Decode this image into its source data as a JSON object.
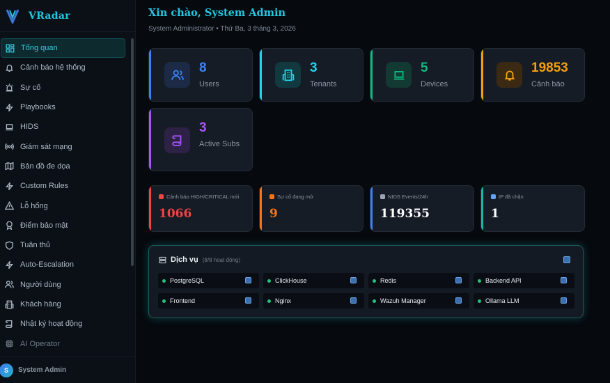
{
  "brand": {
    "name": "VRadar"
  },
  "sidebar": {
    "items": [
      {
        "label": "Tổng quan",
        "icon": "dashboard-icon",
        "active": true
      },
      {
        "label": "Cảnh báo hệ thống",
        "icon": "bell-icon"
      },
      {
        "label": "Sự cố",
        "icon": "incident-icon"
      },
      {
        "label": "Playbooks",
        "icon": "bolt-icon"
      },
      {
        "label": "HIDS",
        "icon": "laptop-icon"
      },
      {
        "label": "Giám sát mạng",
        "icon": "radio-icon"
      },
      {
        "label": "Bản đồ đe dọa",
        "icon": "map-icon"
      },
      {
        "label": "Custom Rules",
        "icon": "bolt-icon"
      },
      {
        "label": "Lỗ hổng",
        "icon": "warning-icon"
      },
      {
        "label": "Điểm bảo mật",
        "icon": "award-icon"
      },
      {
        "label": "Tuân thủ",
        "icon": "shield-icon"
      },
      {
        "label": "Auto-Escalation",
        "icon": "bolt-icon"
      },
      {
        "label": "Người dùng",
        "icon": "users-icon"
      },
      {
        "label": "Khách hàng",
        "icon": "building-icon"
      },
      {
        "label": "Nhật ký hoạt động",
        "icon": "scroll-icon"
      },
      {
        "label": "AI Operator",
        "icon": "cpu-icon"
      }
    ]
  },
  "user": {
    "initial": "S",
    "name": "System Admin"
  },
  "header": {
    "greeting": "Xin chào, System Admin",
    "subtitle": "System Administrator • Thứ Ba, 3 tháng 3, 2026"
  },
  "stats": [
    {
      "value": "8",
      "label": "Users",
      "icon": "users-icon",
      "color": "#3b82f6"
    },
    {
      "value": "3",
      "label": "Tenants",
      "icon": "building-icon",
      "color": "#22d3ee"
    },
    {
      "value": "5",
      "label": "Devices",
      "icon": "laptop-icon",
      "color": "#10b981"
    },
    {
      "value": "19853",
      "label": "Cảnh báo",
      "icon": "bell-icon",
      "color": "#f59e0b"
    },
    {
      "value": "3",
      "label": "Active Subs",
      "icon": "scroll-icon",
      "color": "#a855f7"
    }
  ],
  "metrics": [
    {
      "title": "Cảnh báo HIGH/CRITICAL mới",
      "value": "1066",
      "color": "#ef4444",
      "value_color": "#ef4444"
    },
    {
      "title": "Sự cố đang mở",
      "value": "9",
      "color": "#f97316",
      "value_color": "#f97316"
    },
    {
      "title": "NIDS Events/24h",
      "value": "119355",
      "color": "#3b82f6",
      "value_color": "#ffffff"
    },
    {
      "title": "IP đã chặn",
      "value": "1",
      "color": "#14b8a6",
      "value_color": "#ffffff"
    }
  ],
  "services": {
    "title": "Dịch vụ",
    "count": "(8/8 hoạt động)",
    "items": [
      {
        "name": "PostgreSQL"
      },
      {
        "name": "ClickHouse"
      },
      {
        "name": "Redis"
      },
      {
        "name": "Backend API"
      },
      {
        "name": "Frontend"
      },
      {
        "name": "Nginx"
      },
      {
        "name": "Wazuh Manager"
      },
      {
        "name": "Ollama LLM"
      }
    ]
  }
}
